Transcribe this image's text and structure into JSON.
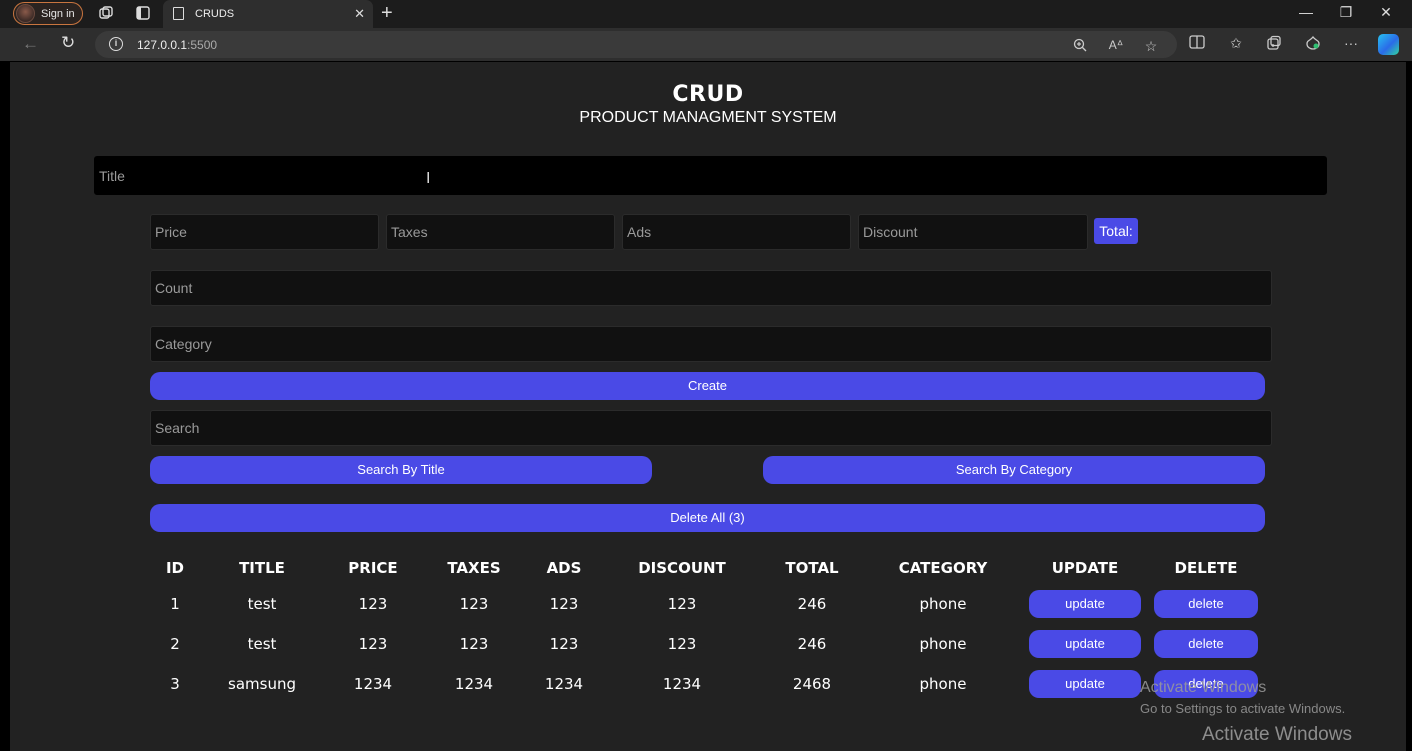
{
  "browser": {
    "signin_label": "Sign in",
    "tab_title": "CRUDS",
    "tab_close": "✕",
    "new_tab": "+",
    "url_host": "127.0.0.1",
    "url_port": ":5500",
    "window_controls": {
      "minimize": "—",
      "restore": "❐",
      "close": "✕"
    }
  },
  "header": {
    "title": "CRUD",
    "subtitle": "PRODUCT MANAGMENT SYSTEM"
  },
  "form": {
    "title_placeholder": "Title",
    "price_placeholder": "Price",
    "taxes_placeholder": "Taxes",
    "ads_placeholder": "Ads",
    "discount_placeholder": "Discount",
    "total_label": "Total:",
    "count_placeholder": "Count",
    "category_placeholder": "Category",
    "create_label": "Create",
    "search_placeholder": "Search",
    "search_by_title_label": "Search By Title",
    "search_by_category_label": "Search By Category",
    "delete_all_label": "Delete All (3)"
  },
  "table": {
    "headers": [
      "ID",
      "TITLE",
      "PRICE",
      "TAXES",
      "ADS",
      "DISCOUNT",
      "TOTAL",
      "CATEGORY",
      "UPDATE",
      "DELETE"
    ],
    "rows": [
      {
        "id": "1",
        "title": "test",
        "price": "123",
        "taxes": "123",
        "ads": "123",
        "discount": "123",
        "total": "246",
        "category": "phone",
        "update": "update",
        "delete": "delete"
      },
      {
        "id": "2",
        "title": "test",
        "price": "123",
        "taxes": "123",
        "ads": "123",
        "discount": "123",
        "total": "246",
        "category": "phone",
        "update": "update",
        "delete": "delete"
      },
      {
        "id": "3",
        "title": "samsung",
        "price": "1234",
        "taxes": "1234",
        "ads": "1234",
        "discount": "1234",
        "total": "2468",
        "category": "phone",
        "update": "update",
        "delete": "delete"
      }
    ]
  },
  "watermark": {
    "line1": "Activate Windows",
    "line2": "Go to Settings to activate Windows.",
    "line3": "Activate Windows"
  },
  "colors": {
    "accent": "#4a4ae6",
    "page_bg": "#222222",
    "input_bg": "#111111"
  },
  "icons": [
    "avatar-icon",
    "workspaces-icon",
    "tab-actions-icon",
    "document-icon",
    "back-icon",
    "reload-icon",
    "site-info-icon",
    "zoom-icon",
    "read-aloud-icon",
    "favorite-star-icon",
    "split-screen-icon",
    "favorites-icon",
    "collections-icon",
    "browser-essentials-icon",
    "more-icon",
    "copilot-icon",
    "text-cursor-icon"
  ]
}
